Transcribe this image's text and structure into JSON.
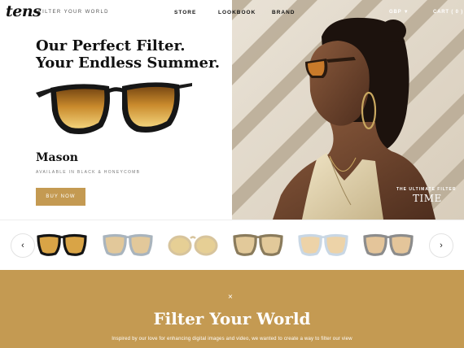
{
  "header": {
    "logo": "tens",
    "tagline": "FILTER YOUR WORLD",
    "nav": [
      "STORE",
      "LOOKBOOK",
      "BRAND"
    ],
    "currency": "GBP ▼",
    "cart": "CART  ( 0 )"
  },
  "hero": {
    "headline_line1": "Our Perfect Filter.",
    "headline_line2": "Your Endless Summer.",
    "product_name": "Mason",
    "product_sub": "AVAILABLE IN BLACK & HONEYCOMB",
    "buy_label": "BUY NOW",
    "press_kicker": "THE ULTIMATE FILTER",
    "press_logo": "TIME"
  },
  "carousel": {
    "prev_icon": "chevron-left-icon",
    "prev_glyph": "‹",
    "next_icon": "chevron-right-icon",
    "next_glyph": "›",
    "items": [
      {
        "frame": "#141414",
        "lens": "#d9a446",
        "style": "square-black"
      },
      {
        "frame": "#a9b4bd",
        "lens": "#e2c89a",
        "style": "clear-grey"
      },
      {
        "frame": "#d7c49c",
        "lens": "#e6cf95",
        "style": "round-gold"
      },
      {
        "frame": "#8a7b5c",
        "lens": "#e2c99a",
        "style": "tortoise"
      },
      {
        "frame": "#c9d7e4",
        "lens": "#edd3a8",
        "style": "clear-blue"
      },
      {
        "frame": "#8c8c8c",
        "lens": "#e4c59a",
        "style": "grey-square"
      }
    ]
  },
  "band": {
    "close_glyph": "×",
    "title": "Filter Your World",
    "body": "Inspired by our love for enhancing digital images and video, we wanted to create a way to filter our view"
  },
  "colors": {
    "accent": "#c49a52",
    "text": "#111111"
  }
}
